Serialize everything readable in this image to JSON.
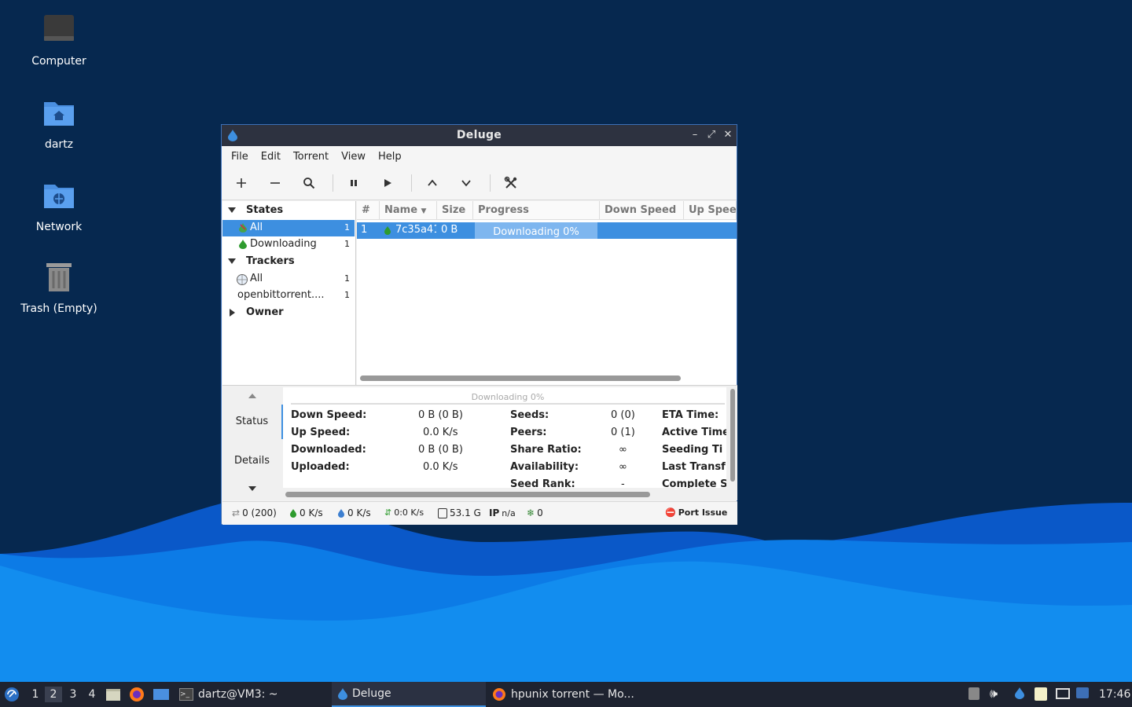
{
  "desktop": {
    "icons": [
      {
        "label": "Computer"
      },
      {
        "label": "dartz"
      },
      {
        "label": "Network"
      },
      {
        "label": "Trash (Empty)"
      }
    ]
  },
  "window": {
    "title": "Deluge",
    "menu": [
      "File",
      "Edit",
      "Torrent",
      "View",
      "Help"
    ],
    "sidebar": {
      "states_header": "States",
      "states": [
        {
          "label": "All",
          "count": "1"
        },
        {
          "label": "Downloading",
          "count": "1"
        }
      ],
      "trackers_header": "Trackers",
      "trackers": [
        {
          "label": "All",
          "count": "1"
        },
        {
          "label": "openbittorrent....",
          "count": "1"
        }
      ],
      "owner_header": "Owner"
    },
    "columns": [
      "#",
      "Name",
      "Size",
      "Progress",
      "Down Speed",
      "Up Spee"
    ],
    "torrents": [
      {
        "num": "1",
        "name": "7c35a41",
        "size": "0 B",
        "progress_text": "Downloading 0%",
        "progress": 0
      }
    ],
    "tabs": [
      "Status",
      "Details"
    ],
    "details": {
      "progress_text": "Downloading 0%",
      "col1": [
        {
          "label": "Down Speed:",
          "value": "0 B (0 B)"
        },
        {
          "label": "Up Speed:",
          "value": "0.0 K/s"
        },
        {
          "label": "Downloaded:",
          "value": "0 B (0 B)"
        },
        {
          "label": "Uploaded:",
          "value": "0.0 K/s"
        }
      ],
      "col2": [
        {
          "label": "Seeds:",
          "value": "0 (0)"
        },
        {
          "label": "Peers:",
          "value": "0 (1)"
        },
        {
          "label": "Share Ratio:",
          "value": "∞"
        },
        {
          "label": "Availability:",
          "value": "∞"
        },
        {
          "label": "Seed Rank:",
          "value": "-"
        }
      ],
      "col3": [
        "ETA Time:",
        "Active Time",
        "Seeding Ti",
        "Last Transf",
        "Complete S"
      ]
    },
    "statusbar": {
      "connections": "0 (200)",
      "down": "0 K/s",
      "up": "0 K/s",
      "protocol": "0:0 K/s",
      "disk": "53.1 G",
      "ip_label": "IP",
      "ip": "n/a",
      "dht": "0",
      "port": "Port Issue"
    }
  },
  "taskbar": {
    "workspaces": [
      "1",
      "2",
      "3",
      "4"
    ],
    "tasks": [
      {
        "label": "dartz@VM3: ~"
      },
      {
        "label": "Deluge"
      },
      {
        "label": "hpunix torrent — Mo..."
      }
    ],
    "clock": "17:46"
  },
  "colors": {
    "accent": "#3d8fe0",
    "titlebar": "#2d3240",
    "taskbar": "#1e2330"
  }
}
